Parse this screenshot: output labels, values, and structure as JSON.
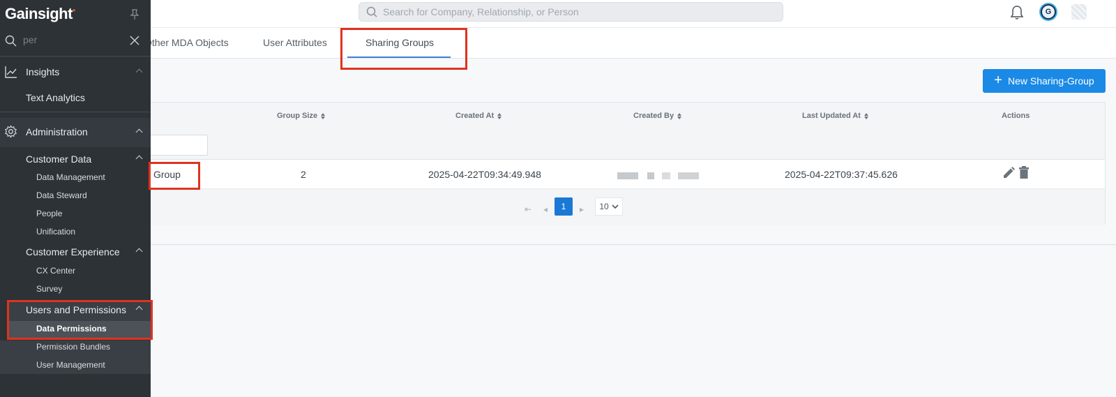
{
  "header": {
    "search_placeholder": "Search for Company, Relationship, or Person",
    "profile_initial": "G"
  },
  "tabs": [
    {
      "label": "Other MDA Objects"
    },
    {
      "label": "User Attributes"
    },
    {
      "label": "Sharing Groups",
      "active": true
    }
  ],
  "toolbar": {
    "new_button_label": "New Sharing-Group"
  },
  "grid": {
    "columns": [
      "Group Size",
      "Created At",
      "Created By",
      "Last Updated At",
      "Actions"
    ],
    "rows": [
      {
        "name": "Group",
        "group_size": "2",
        "created_at": "2025-04-22T09:34:49.948",
        "created_by": "(redacted)",
        "last_updated_at": "2025-04-22T09:37:45.626"
      }
    ],
    "pagination": {
      "current_page": "1",
      "page_size": "10"
    }
  },
  "sidebar": {
    "logo": "Gainsight",
    "search_value": "per",
    "items": [
      {
        "label": "Insights",
        "level": 1,
        "icon": "chart-line-icon"
      },
      {
        "label": "Text Analytics",
        "level": 2
      },
      {
        "label": "Administration",
        "level": 1,
        "icon": "gear-icon"
      },
      {
        "label": "Customer Data",
        "level": 2
      },
      {
        "label": "Data Management",
        "level": 3
      },
      {
        "label": "Data Steward",
        "level": 3
      },
      {
        "label": "People",
        "level": 3
      },
      {
        "label": "Unification",
        "level": 3
      },
      {
        "label": "Customer Experience",
        "level": 2
      },
      {
        "label": "CX Center",
        "level": 3
      },
      {
        "label": "Survey",
        "level": 3
      },
      {
        "label": "Users and Permissions",
        "level": 2
      },
      {
        "label": "Data Permissions",
        "level": 3,
        "selected": true
      },
      {
        "label": "Permission Bundles",
        "level": 3
      },
      {
        "label": "User Management",
        "level": 3
      }
    ]
  },
  "colors": {
    "accent": "#1b8ae6",
    "highlight": "#e0321f",
    "sidebar_bg": "#2d3237"
  }
}
